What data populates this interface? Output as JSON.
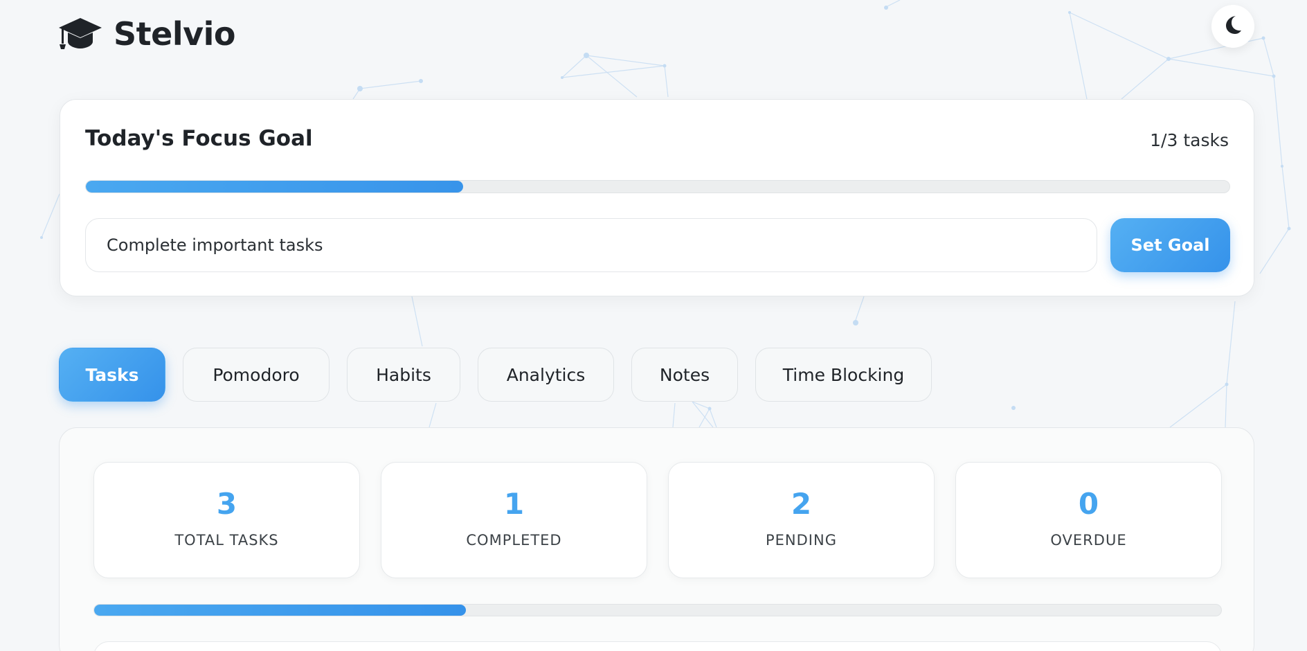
{
  "app": {
    "brand_name": "Stelvio",
    "logo_icon": "graduation-cap-icon",
    "theme_toggle_icon": "moon-icon"
  },
  "goal": {
    "title": "Today's Focus Goal",
    "count_text": "1/3 tasks",
    "progress_fraction": 0.33,
    "input_value": "Complete important tasks",
    "set_button_label": "Set Goal"
  },
  "tabs": [
    {
      "label": "Tasks",
      "active": true
    },
    {
      "label": "Pomodoro",
      "active": false
    },
    {
      "label": "Habits",
      "active": false
    },
    {
      "label": "Analytics",
      "active": false
    },
    {
      "label": "Notes",
      "active": false
    },
    {
      "label": "Time Blocking",
      "active": false
    }
  ],
  "stats": [
    {
      "value": "3",
      "label": "TOTAL TASKS"
    },
    {
      "value": "1",
      "label": "COMPLETED"
    },
    {
      "value": "2",
      "label": "PENDING"
    },
    {
      "value": "0",
      "label": "OVERDUE"
    }
  ],
  "tasks_progress_fraction": 0.33,
  "colors": {
    "accent": "#45a4ef",
    "accent_dark": "#3592ea",
    "background": "#f5f7f9",
    "text": "#1f2328"
  }
}
